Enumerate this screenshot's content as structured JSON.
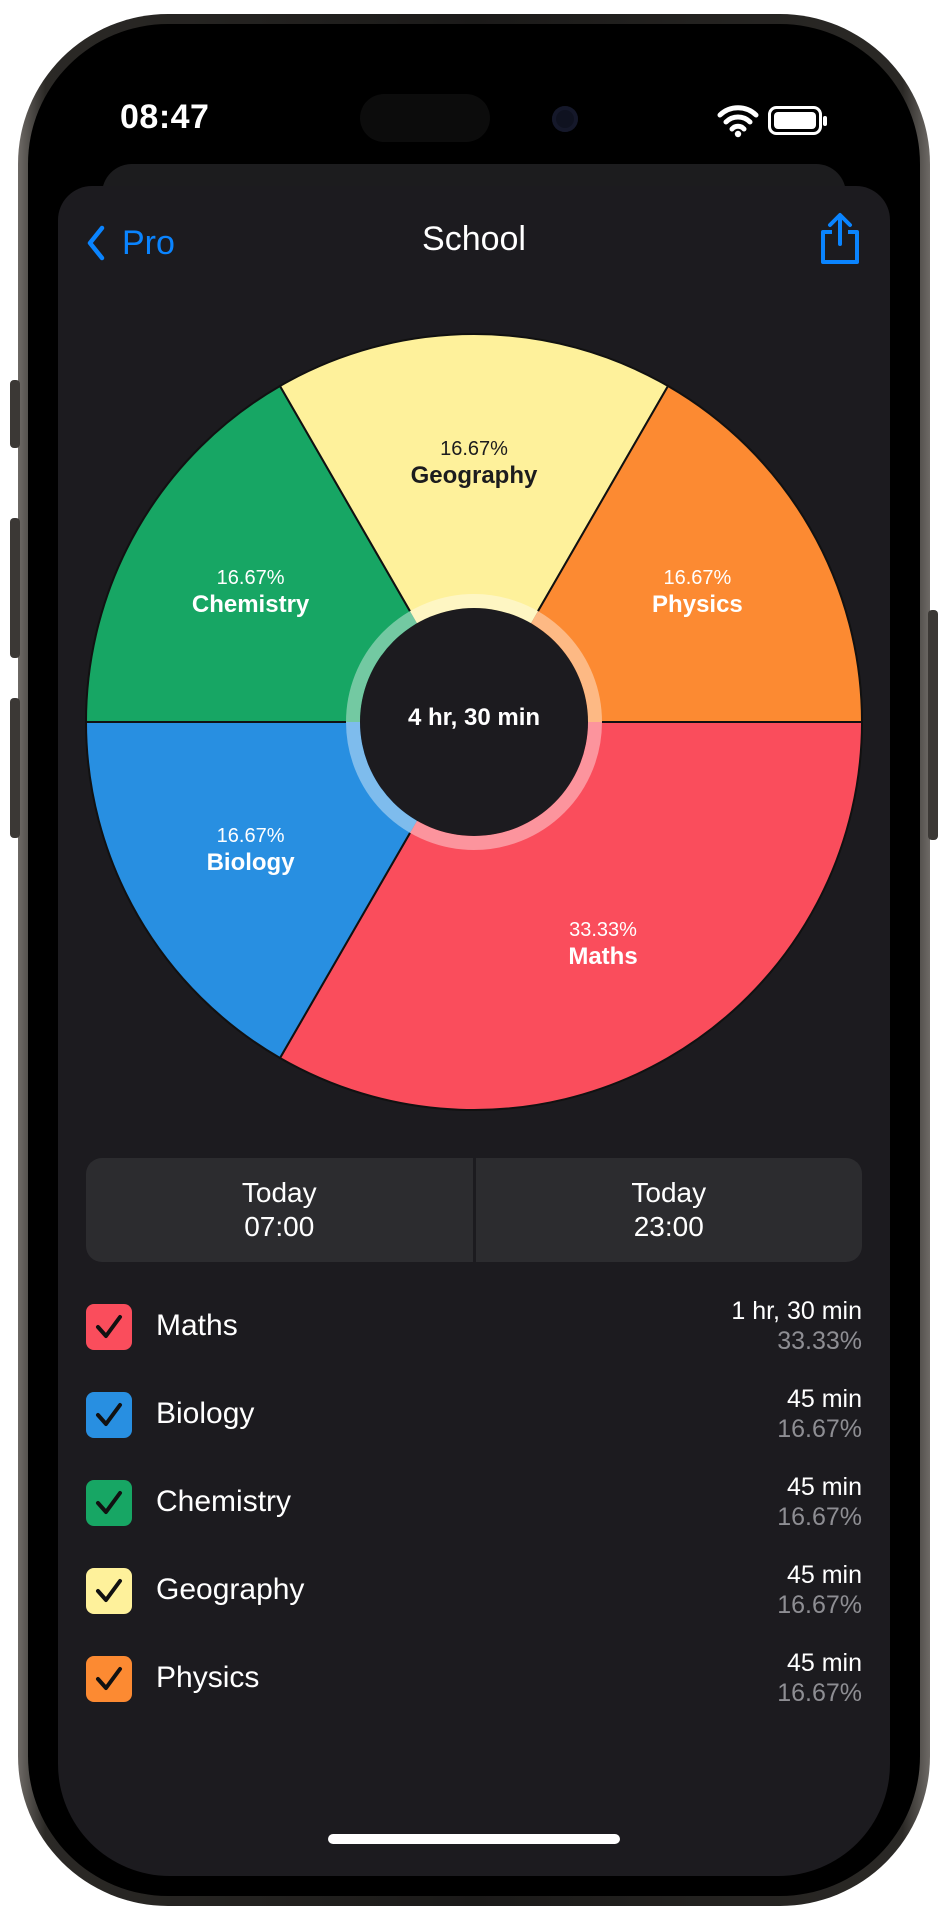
{
  "status_bar": {
    "time": "08:47"
  },
  "nav": {
    "back_label": "Pro",
    "title": "School"
  },
  "chart_data": {
    "type": "pie",
    "center_label": "4 hr, 30 min",
    "series": [
      {
        "values": [
          2,
          1,
          1,
          1,
          1
        ]
      }
    ],
    "slices": [
      {
        "name": "Maths",
        "value": 90,
        "percent": "33.33%",
        "color": "#fa4d5c",
        "label_color": "#ffffff"
      },
      {
        "name": "Biology",
        "value": 45,
        "percent": "16.67%",
        "color": "#288fe1",
        "label_color": "#ffffff"
      },
      {
        "name": "Chemistry",
        "value": 45,
        "percent": "16.67%",
        "color": "#17a664",
        "label_color": "#ffffff"
      },
      {
        "name": "Geography",
        "value": 45,
        "percent": "16.67%",
        "color": "#fef19b",
        "label_color": "#1c1c1e"
      },
      {
        "name": "Physics",
        "value": 45,
        "percent": "16.67%",
        "color": "#fc8a32",
        "label_color": "#ffffff"
      }
    ]
  },
  "range": {
    "start": {
      "day": "Today",
      "time": "07:00"
    },
    "end": {
      "day": "Today",
      "time": "23:00"
    }
  },
  "legend": [
    {
      "name": "Maths",
      "duration": "1 hr, 30 min",
      "percent": "33.33%",
      "color": "#fa4d5c",
      "checked": true
    },
    {
      "name": "Biology",
      "duration": "45 min",
      "percent": "16.67%",
      "color": "#288fe1",
      "checked": true
    },
    {
      "name": "Chemistry",
      "duration": "45 min",
      "percent": "16.67%",
      "color": "#17a664",
      "checked": true
    },
    {
      "name": "Geography",
      "duration": "45 min",
      "percent": "16.67%",
      "color": "#fef19b",
      "checked": true
    },
    {
      "name": "Physics",
      "duration": "45 min",
      "percent": "16.67%",
      "color": "#fc8a32",
      "checked": true
    }
  ],
  "icons": {
    "back": "chevron-left-icon",
    "share": "share-icon",
    "wifi": "wifi-icon",
    "battery": "battery-icon",
    "check": "checkmark-icon"
  },
  "colors": {
    "accent": "#0a84ff",
    "background": "#1c1b1f",
    "card": "#2c2c2f",
    "secondary_text": "#8e8e93"
  }
}
